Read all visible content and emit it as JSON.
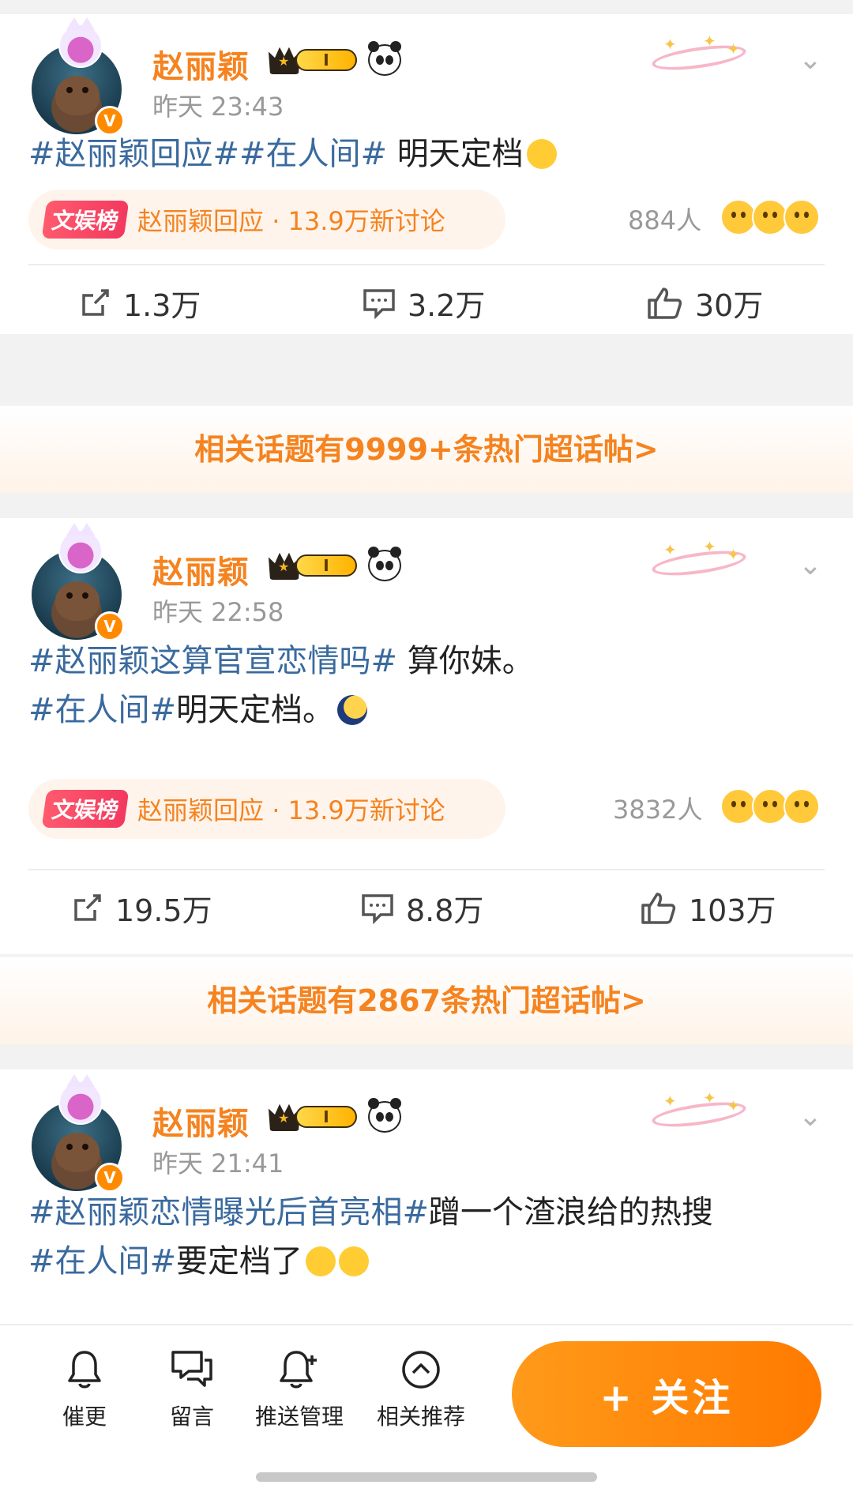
{
  "posts": [
    {
      "author": "赵丽颖",
      "vip_level": "I",
      "time": "昨天 23:43",
      "content": [
        {
          "text": "#赵丽颖回应#",
          "tag": true
        },
        {
          "text": "#在人间#",
          "tag": true
        },
        {
          "text": " 明天定档",
          "tag": false
        }
      ],
      "hot_label": "文娱榜",
      "hot_text": "赵丽颖回应 · 13.9万新讨论",
      "people": "884人",
      "share": "1.3万",
      "comments": "3.2万",
      "likes": "30万",
      "related": "相关话题有9999+条热门超话帖>"
    },
    {
      "author": "赵丽颖",
      "vip_level": "I",
      "time": "昨天 22:58",
      "content_line1": [
        {
          "text": "#赵丽颖这算官宣恋情吗#",
          "tag": true
        },
        {
          "text": " 算你妹。",
          "tag": false
        }
      ],
      "content_line2": [
        {
          "text": "#在人间#",
          "tag": true
        },
        {
          "text": "明天定档。",
          "tag": false
        }
      ],
      "hot_label": "文娱榜",
      "hot_text": "赵丽颖回应 · 13.9万新讨论",
      "people": "3832人",
      "share": "19.5万",
      "comments": "8.8万",
      "likes": "103万",
      "related": "相关话题有2867条热门超话帖>"
    },
    {
      "author": "赵丽颖",
      "vip_level": "I",
      "time": "昨天 21:41",
      "content_line1": [
        {
          "text": "#赵丽颖恋情曝光后首亮相#",
          "tag": true
        },
        {
          "text": "蹭一个渣浪给的热搜",
          "tag": false
        }
      ],
      "content_line2": [
        {
          "text": "#在人间#",
          "tag": true
        },
        {
          "text": "要定档了",
          "tag": false
        }
      ]
    }
  ],
  "bottom_bar": {
    "items": [
      "催更",
      "留言",
      "推送管理",
      "相关推荐"
    ],
    "follow_label": "+ 关注"
  },
  "colors": {
    "accent_orange": "#f5831f",
    "topic_blue": "#3a6a9e",
    "follow_button": "#ff8a00"
  }
}
